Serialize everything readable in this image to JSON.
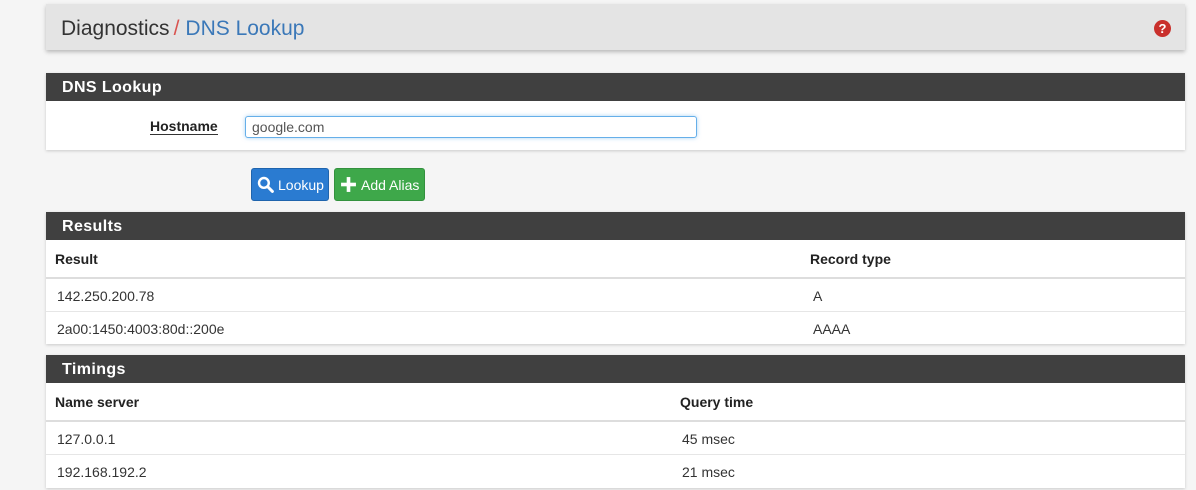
{
  "breadcrumb": {
    "section": "Diagnostics",
    "separator": "/",
    "page": "DNS Lookup"
  },
  "help_icon": "question-circle-icon",
  "form_panel": {
    "title": "DNS Lookup",
    "hostname_label": "Hostname",
    "hostname_value": "google.com"
  },
  "buttons": {
    "lookup": "Lookup",
    "add_alias": "Add Alias"
  },
  "results": {
    "title": "Results",
    "columns": [
      "Result",
      "Record type"
    ],
    "rows": [
      {
        "result": "142.250.200.78",
        "type": "A"
      },
      {
        "result": "2a00:1450:4003:80d::200e",
        "type": "AAAA"
      }
    ]
  },
  "timings": {
    "title": "Timings",
    "columns": [
      "Name server",
      "Query time"
    ],
    "rows": [
      {
        "server": "127.0.0.1",
        "time": "45 msec"
      },
      {
        "server": "192.168.192.2",
        "time": "21 msec"
      }
    ]
  },
  "colors": {
    "panel_header": "#404040",
    "lookup_button": "#2a7bd1",
    "add_alias_button": "#3ea84a",
    "link": "#3b78b8",
    "help": "#c9302c"
  }
}
